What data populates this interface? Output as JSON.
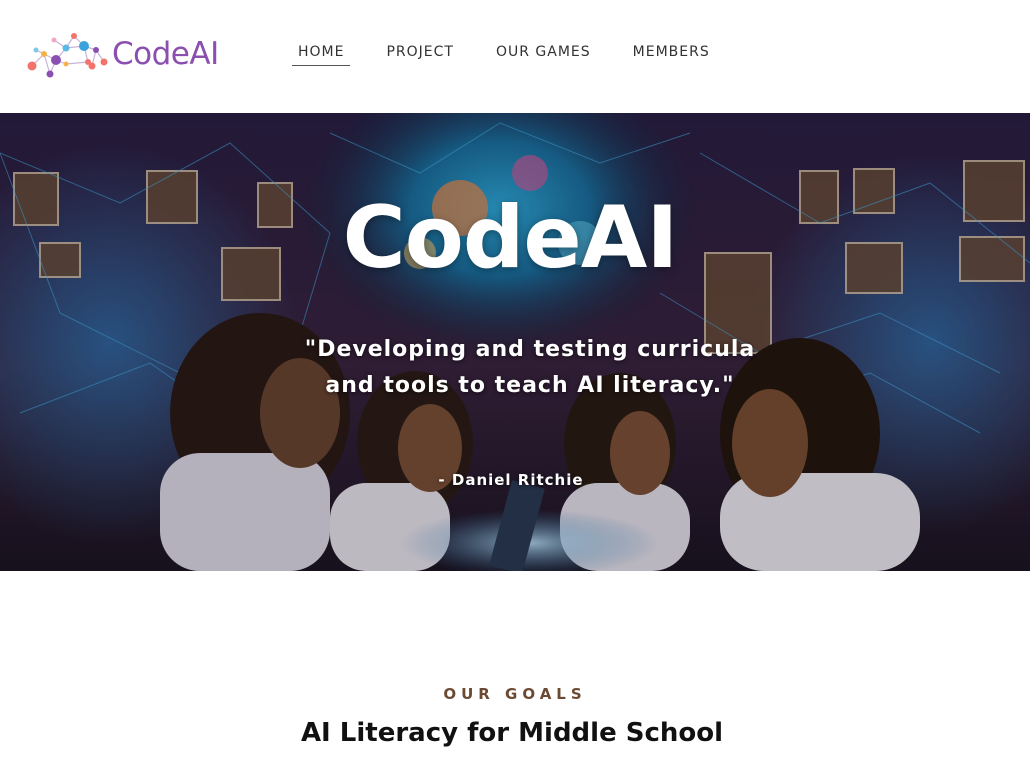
{
  "header": {
    "logo_text": "CodeAI",
    "nav": [
      {
        "label": "HOME",
        "active": true
      },
      {
        "label": "PROJECT",
        "active": false
      },
      {
        "label": "OUR GAMES",
        "active": false
      },
      {
        "label": "MEMBERS",
        "active": false
      }
    ]
  },
  "hero": {
    "title": "CodeAI",
    "quote": "\"Developing and testing curricula and tools to teach AI literacy.\"",
    "author": "- Daniel Ritchie"
  },
  "goals": {
    "kicker": "OUR GOALS",
    "title": "AI Literacy for Middle School"
  },
  "colors": {
    "brand_purple": "#8b4fb0",
    "nav_text": "#333333",
    "kicker_brown": "#6b4a33",
    "hero_text": "#ffffff"
  },
  "icons": {
    "logo_mark": "network-dots-icon"
  }
}
